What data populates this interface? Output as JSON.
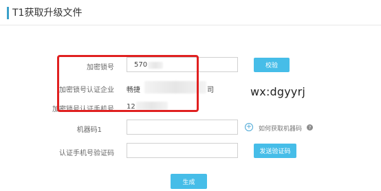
{
  "page": {
    "title": "T1获取升级文件"
  },
  "form": {
    "encryption_lock": {
      "label": "加密锁号",
      "value": "570"
    },
    "verify_button": "校验",
    "certified_company": {
      "label": "加密锁号认证企业",
      "value_prefix": "畅捷",
      "value_suffix": "司"
    },
    "certified_phone": {
      "label": "加密锁号认证手机号",
      "value": "12"
    },
    "machine_code": {
      "label": "机器码1",
      "value": ""
    },
    "help_link": "如何获取机器码",
    "verification_code": {
      "label": "认证手机号验证码",
      "value": ""
    },
    "send_code_button": "发送验证码",
    "generate_button": "生成"
  },
  "overlay": {
    "watermark": "wx:dgyyrj"
  },
  "icons": {
    "add": "plus-circle-icon",
    "help": "question-circle-icon"
  },
  "colors": {
    "accent": "#46bde8",
    "highlight_border": "#e02020",
    "title_bar": "#3aa0c9"
  }
}
